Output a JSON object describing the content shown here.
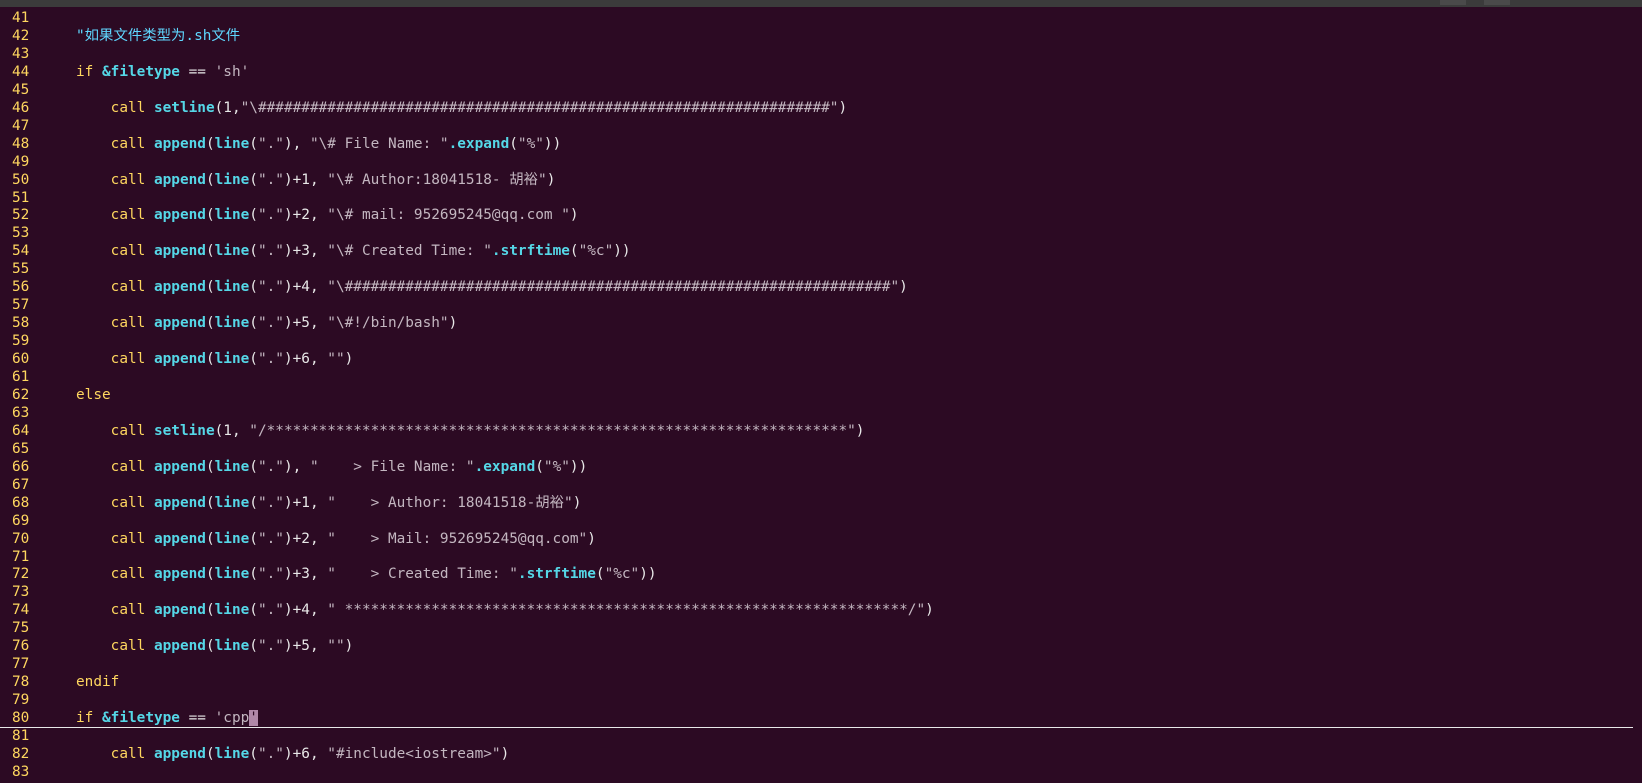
{
  "colors": {
    "background": "#2c0a23",
    "line_number": "#ffd75f",
    "keyword": "#ffd75f",
    "function": "#55d7e7",
    "string": "#c3b6c0",
    "comment": "#5fd7ff"
  },
  "editor": {
    "lines": [
      {
        "num": "41",
        "tokens": []
      },
      {
        "num": "42",
        "tokens": [
          {
            "t": "com",
            "s": "\"如果文件类型为.sh文件"
          }
        ]
      },
      {
        "num": "43",
        "tokens": []
      },
      {
        "num": "44",
        "tokens": [
          {
            "t": "kw",
            "s": "if "
          },
          {
            "t": "fn",
            "s": "&filetype"
          },
          {
            "t": "plain",
            "s": " == "
          },
          {
            "t": "str",
            "s": "'sh'"
          }
        ]
      },
      {
        "num": "45",
        "tokens": []
      },
      {
        "num": "46",
        "tokens": [
          {
            "t": "plain",
            "s": "    "
          },
          {
            "t": "kw",
            "s": "call "
          },
          {
            "t": "fn",
            "s": "setline"
          },
          {
            "t": "plain",
            "s": "(1,"
          },
          {
            "t": "str",
            "s": "\"\\##################################################################\""
          },
          {
            "t": "plain",
            "s": ")"
          }
        ]
      },
      {
        "num": "47",
        "tokens": []
      },
      {
        "num": "48",
        "tokens": [
          {
            "t": "plain",
            "s": "    "
          },
          {
            "t": "kw",
            "s": "call "
          },
          {
            "t": "fn",
            "s": "append"
          },
          {
            "t": "plain",
            "s": "("
          },
          {
            "t": "fn",
            "s": "line"
          },
          {
            "t": "plain",
            "s": "("
          },
          {
            "t": "str",
            "s": "\".\""
          },
          {
            "t": "plain",
            "s": "), "
          },
          {
            "t": "str",
            "s": "\"\\# File Name: \""
          },
          {
            "t": "fn",
            "s": ".expand"
          },
          {
            "t": "plain",
            "s": "("
          },
          {
            "t": "str",
            "s": "\"%\""
          },
          {
            "t": "plain",
            "s": "))"
          }
        ]
      },
      {
        "num": "49",
        "tokens": []
      },
      {
        "num": "50",
        "tokens": [
          {
            "t": "plain",
            "s": "    "
          },
          {
            "t": "kw",
            "s": "call "
          },
          {
            "t": "fn",
            "s": "append"
          },
          {
            "t": "plain",
            "s": "("
          },
          {
            "t": "fn",
            "s": "line"
          },
          {
            "t": "plain",
            "s": "("
          },
          {
            "t": "str",
            "s": "\".\""
          },
          {
            "t": "plain",
            "s": ")+1, "
          },
          {
            "t": "str",
            "s": "\"\\# Author:18041518- 胡裕\""
          },
          {
            "t": "plain",
            "s": ")"
          }
        ]
      },
      {
        "num": "51",
        "tokens": []
      },
      {
        "num": "52",
        "tokens": [
          {
            "t": "plain",
            "s": "    "
          },
          {
            "t": "kw",
            "s": "call "
          },
          {
            "t": "fn",
            "s": "append"
          },
          {
            "t": "plain",
            "s": "("
          },
          {
            "t": "fn",
            "s": "line"
          },
          {
            "t": "plain",
            "s": "("
          },
          {
            "t": "str",
            "s": "\".\""
          },
          {
            "t": "plain",
            "s": ")+2, "
          },
          {
            "t": "str",
            "s": "\"\\# mail: 952695245@qq.com \""
          },
          {
            "t": "plain",
            "s": ")"
          }
        ]
      },
      {
        "num": "53",
        "tokens": []
      },
      {
        "num": "54",
        "tokens": [
          {
            "t": "plain",
            "s": "    "
          },
          {
            "t": "kw",
            "s": "call "
          },
          {
            "t": "fn",
            "s": "append"
          },
          {
            "t": "plain",
            "s": "("
          },
          {
            "t": "fn",
            "s": "line"
          },
          {
            "t": "plain",
            "s": "("
          },
          {
            "t": "str",
            "s": "\".\""
          },
          {
            "t": "plain",
            "s": ")+3, "
          },
          {
            "t": "str",
            "s": "\"\\# Created Time: \""
          },
          {
            "t": "fn",
            "s": ".strftime"
          },
          {
            "t": "plain",
            "s": "("
          },
          {
            "t": "str",
            "s": "\"%c\""
          },
          {
            "t": "plain",
            "s": "))"
          }
        ]
      },
      {
        "num": "55",
        "tokens": []
      },
      {
        "num": "56",
        "tokens": [
          {
            "t": "plain",
            "s": "    "
          },
          {
            "t": "kw",
            "s": "call "
          },
          {
            "t": "fn",
            "s": "append"
          },
          {
            "t": "plain",
            "s": "("
          },
          {
            "t": "fn",
            "s": "line"
          },
          {
            "t": "plain",
            "s": "("
          },
          {
            "t": "str",
            "s": "\".\""
          },
          {
            "t": "plain",
            "s": ")+4, "
          },
          {
            "t": "str",
            "s": "\"\\###############################################################\""
          },
          {
            "t": "plain",
            "s": ")"
          }
        ]
      },
      {
        "num": "57",
        "tokens": []
      },
      {
        "num": "58",
        "tokens": [
          {
            "t": "plain",
            "s": "    "
          },
          {
            "t": "kw",
            "s": "call "
          },
          {
            "t": "fn",
            "s": "append"
          },
          {
            "t": "plain",
            "s": "("
          },
          {
            "t": "fn",
            "s": "line"
          },
          {
            "t": "plain",
            "s": "("
          },
          {
            "t": "str",
            "s": "\".\""
          },
          {
            "t": "plain",
            "s": ")+5, "
          },
          {
            "t": "str",
            "s": "\"\\#!/bin/bash\""
          },
          {
            "t": "plain",
            "s": ")"
          }
        ]
      },
      {
        "num": "59",
        "tokens": []
      },
      {
        "num": "60",
        "tokens": [
          {
            "t": "plain",
            "s": "    "
          },
          {
            "t": "kw",
            "s": "call "
          },
          {
            "t": "fn",
            "s": "append"
          },
          {
            "t": "plain",
            "s": "("
          },
          {
            "t": "fn",
            "s": "line"
          },
          {
            "t": "plain",
            "s": "("
          },
          {
            "t": "str",
            "s": "\".\""
          },
          {
            "t": "plain",
            "s": ")+6, "
          },
          {
            "t": "str",
            "s": "\"\""
          },
          {
            "t": "plain",
            "s": ")"
          }
        ]
      },
      {
        "num": "61",
        "tokens": []
      },
      {
        "num": "62",
        "tokens": [
          {
            "t": "kw",
            "s": "else"
          }
        ]
      },
      {
        "num": "63",
        "tokens": []
      },
      {
        "num": "64",
        "tokens": [
          {
            "t": "plain",
            "s": "    "
          },
          {
            "t": "kw",
            "s": "call "
          },
          {
            "t": "fn",
            "s": "setline"
          },
          {
            "t": "plain",
            "s": "(1, "
          },
          {
            "t": "str",
            "s": "\"/*******************************************************************\""
          },
          {
            "t": "plain",
            "s": ")"
          }
        ]
      },
      {
        "num": "65",
        "tokens": []
      },
      {
        "num": "66",
        "tokens": [
          {
            "t": "plain",
            "s": "    "
          },
          {
            "t": "kw",
            "s": "call "
          },
          {
            "t": "fn",
            "s": "append"
          },
          {
            "t": "plain",
            "s": "("
          },
          {
            "t": "fn",
            "s": "line"
          },
          {
            "t": "plain",
            "s": "("
          },
          {
            "t": "str",
            "s": "\".\""
          },
          {
            "t": "plain",
            "s": "), "
          },
          {
            "t": "str",
            "s": "\"    > File Name: \""
          },
          {
            "t": "fn",
            "s": ".expand"
          },
          {
            "t": "plain",
            "s": "("
          },
          {
            "t": "str",
            "s": "\"%\""
          },
          {
            "t": "plain",
            "s": "))"
          }
        ]
      },
      {
        "num": "67",
        "tokens": []
      },
      {
        "num": "68",
        "tokens": [
          {
            "t": "plain",
            "s": "    "
          },
          {
            "t": "kw",
            "s": "call "
          },
          {
            "t": "fn",
            "s": "append"
          },
          {
            "t": "plain",
            "s": "("
          },
          {
            "t": "fn",
            "s": "line"
          },
          {
            "t": "plain",
            "s": "("
          },
          {
            "t": "str",
            "s": "\".\""
          },
          {
            "t": "plain",
            "s": ")+1, "
          },
          {
            "t": "str",
            "s": "\"    > Author: 18041518-胡裕\""
          },
          {
            "t": "plain",
            "s": ")"
          }
        ]
      },
      {
        "num": "69",
        "tokens": []
      },
      {
        "num": "70",
        "tokens": [
          {
            "t": "plain",
            "s": "    "
          },
          {
            "t": "kw",
            "s": "call "
          },
          {
            "t": "fn",
            "s": "append"
          },
          {
            "t": "plain",
            "s": "("
          },
          {
            "t": "fn",
            "s": "line"
          },
          {
            "t": "plain",
            "s": "("
          },
          {
            "t": "str",
            "s": "\".\""
          },
          {
            "t": "plain",
            "s": ")+2, "
          },
          {
            "t": "str",
            "s": "\"    > Mail: 952695245@qq.com\""
          },
          {
            "t": "plain",
            "s": ")"
          }
        ]
      },
      {
        "num": "71",
        "tokens": []
      },
      {
        "num": "72",
        "tokens": [
          {
            "t": "plain",
            "s": "    "
          },
          {
            "t": "kw",
            "s": "call "
          },
          {
            "t": "fn",
            "s": "append"
          },
          {
            "t": "plain",
            "s": "("
          },
          {
            "t": "fn",
            "s": "line"
          },
          {
            "t": "plain",
            "s": "("
          },
          {
            "t": "str",
            "s": "\".\""
          },
          {
            "t": "plain",
            "s": ")+3, "
          },
          {
            "t": "str",
            "s": "\"    > Created Time: \""
          },
          {
            "t": "fn",
            "s": ".strftime"
          },
          {
            "t": "plain",
            "s": "("
          },
          {
            "t": "str",
            "s": "\"%c\""
          },
          {
            "t": "plain",
            "s": "))"
          }
        ]
      },
      {
        "num": "73",
        "tokens": []
      },
      {
        "num": "74",
        "tokens": [
          {
            "t": "plain",
            "s": "    "
          },
          {
            "t": "kw",
            "s": "call "
          },
          {
            "t": "fn",
            "s": "append"
          },
          {
            "t": "plain",
            "s": "("
          },
          {
            "t": "fn",
            "s": "line"
          },
          {
            "t": "plain",
            "s": "("
          },
          {
            "t": "str",
            "s": "\".\""
          },
          {
            "t": "plain",
            "s": ")+4, "
          },
          {
            "t": "str",
            "s": "\" *****************************************************************/\""
          },
          {
            "t": "plain",
            "s": ")"
          }
        ]
      },
      {
        "num": "75",
        "tokens": []
      },
      {
        "num": "76",
        "tokens": [
          {
            "t": "plain",
            "s": "    "
          },
          {
            "t": "kw",
            "s": "call "
          },
          {
            "t": "fn",
            "s": "append"
          },
          {
            "t": "plain",
            "s": "("
          },
          {
            "t": "fn",
            "s": "line"
          },
          {
            "t": "plain",
            "s": "("
          },
          {
            "t": "str",
            "s": "\".\""
          },
          {
            "t": "plain",
            "s": ")+5, "
          },
          {
            "t": "str",
            "s": "\"\""
          },
          {
            "t": "plain",
            "s": ")"
          }
        ]
      },
      {
        "num": "77",
        "tokens": []
      },
      {
        "num": "78",
        "tokens": [
          {
            "t": "kw",
            "s": "endif"
          }
        ]
      },
      {
        "num": "79",
        "tokens": []
      },
      {
        "num": "80",
        "tokens": [
          {
            "t": "kw",
            "s": "if "
          },
          {
            "t": "fn",
            "s": "&filetype"
          },
          {
            "t": "plain",
            "s": " == "
          },
          {
            "t": "str",
            "s": "'cpp"
          },
          {
            "t": "cursor",
            "s": "'"
          }
        ]
      },
      {
        "num": "81",
        "tokens": []
      },
      {
        "num": "82",
        "tokens": [
          {
            "t": "plain",
            "s": "    "
          },
          {
            "t": "kw",
            "s": "call "
          },
          {
            "t": "fn",
            "s": "append"
          },
          {
            "t": "plain",
            "s": "("
          },
          {
            "t": "fn",
            "s": "line"
          },
          {
            "t": "plain",
            "s": "("
          },
          {
            "t": "str",
            "s": "\".\""
          },
          {
            "t": "plain",
            "s": ")+6, "
          },
          {
            "t": "str",
            "s": "\"#include<iostream>\""
          },
          {
            "t": "plain",
            "s": ")"
          }
        ]
      },
      {
        "num": "83",
        "tokens": []
      }
    ]
  }
}
